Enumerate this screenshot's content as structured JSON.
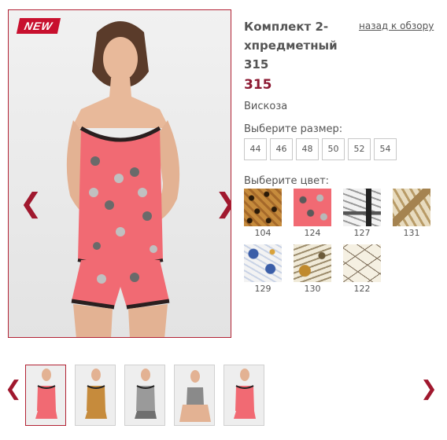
{
  "badge": {
    "label": "NEW"
  },
  "gallery": {
    "prev_icon": "chevron-left-icon",
    "next_icon": "chevron-right-icon",
    "prev_glyph": "❮",
    "next_glyph": "❯"
  },
  "product": {
    "title": "Комплект 2-хпредметный 315",
    "back_link": "назад к обзору",
    "price": "315",
    "material": "Вискоза"
  },
  "sizes": {
    "label": "Выберите размер:",
    "options": [
      "44",
      "46",
      "48",
      "50",
      "52",
      "54"
    ]
  },
  "colors": {
    "label": "Выберите цвет:",
    "options": [
      "104",
      "124",
      "127",
      "131",
      "129",
      "130",
      "122"
    ]
  },
  "thumbnails": {
    "prev_glyph": "❮",
    "next_glyph": "❯",
    "count": 5,
    "active_index": 0
  },
  "palette": {
    "accent": "#b22234",
    "price": "#8c1a33",
    "pajama_pink": "#f16a73"
  }
}
